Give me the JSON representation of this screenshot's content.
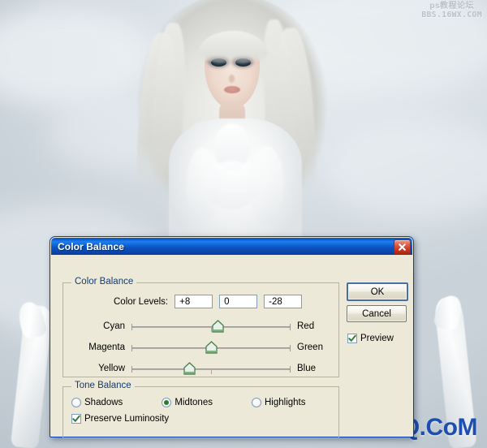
{
  "photo": {
    "description": "young woman with long platinum-white hair in white ruffled dress against pale gray sky",
    "sky_color": "#d4dce2",
    "hair_color": "#e3e3df",
    "dress_color": "#f6f7f7"
  },
  "watermarks": {
    "top_line1": "ps教程论坛",
    "top_line2": "BBS.16WX.COM",
    "top_color": "#b9c2c9",
    "bottom": "UiBQ.CoM",
    "bottom_color": "#1c4fb0"
  },
  "dialog": {
    "title": "Color Balance",
    "close_label": "Close",
    "titlebar_color": "#0b54c4",
    "face_color": "#ece9d8",
    "groups": {
      "color_balance": {
        "legend": "Color Balance",
        "levels_label": "Color Levels:",
        "levels": [
          "+8",
          "0",
          "-28"
        ],
        "sliders": [
          {
            "left": "Cyan",
            "right": "Red",
            "value": 8,
            "pos_pct": 54
          },
          {
            "left": "Magenta",
            "right": "Green",
            "value": 0,
            "pos_pct": 50
          },
          {
            "left": "Yellow",
            "right": "Blue",
            "value": -28,
            "pos_pct": 36
          }
        ]
      },
      "tone_balance": {
        "legend": "Tone Balance",
        "options": [
          {
            "label": "Shadows",
            "selected": false
          },
          {
            "label": "Midtones",
            "selected": true
          },
          {
            "label": "Highlights",
            "selected": false
          }
        ],
        "preserve_luminosity": {
          "label": "Preserve Luminosity",
          "checked": true
        }
      }
    },
    "buttons": {
      "ok": "OK",
      "cancel": "Cancel"
    },
    "preview": {
      "label": "Preview",
      "checked": true
    }
  }
}
